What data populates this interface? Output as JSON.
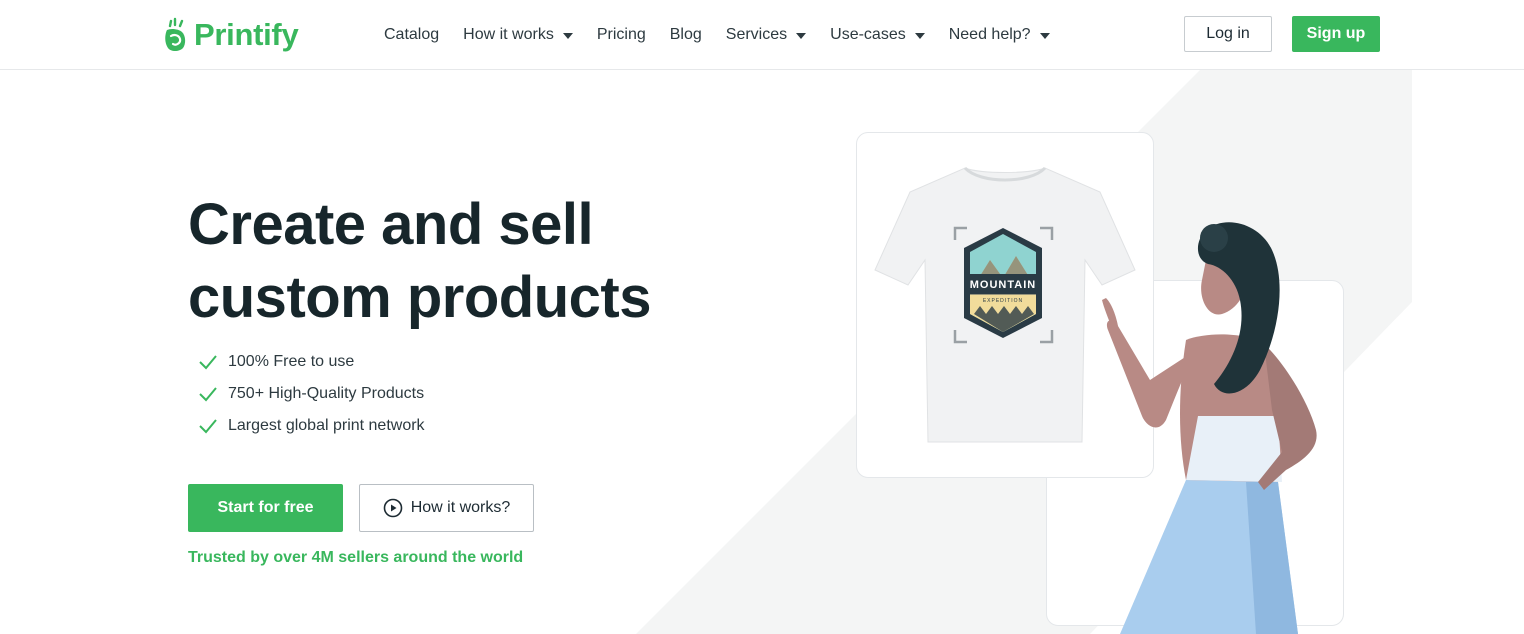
{
  "header": {
    "brand": "Printify",
    "nav": [
      {
        "label": "Catalog",
        "dropdown": false
      },
      {
        "label": "How it works",
        "dropdown": true
      },
      {
        "label": "Pricing",
        "dropdown": false
      },
      {
        "label": "Blog",
        "dropdown": false
      },
      {
        "label": "Services",
        "dropdown": true
      },
      {
        "label": "Use-cases",
        "dropdown": true
      },
      {
        "label": "Need help?",
        "dropdown": true
      }
    ],
    "login_label": "Log in",
    "signup_label": "Sign up"
  },
  "hero": {
    "title_line1": "Create and sell",
    "title_line2": "custom products",
    "features": [
      "100% Free to use",
      "750+ High-Quality Products",
      "Largest global print network"
    ],
    "start_label": "Start for free",
    "how_label": "How it works?",
    "trusted": "Trusted by over 4M sellers around the world"
  },
  "product": {
    "badge_title": "MOUNTAIN",
    "badge_subtitle": "EXPEDITION"
  },
  "colors": {
    "brand": "#39b75d",
    "text": "#17262b",
    "bg_shape": "#f4f5f5"
  },
  "icons": {
    "logo": "printify-logo-icon",
    "check": "check-icon",
    "play": "play-circle-icon",
    "caret": "caret-down-icon"
  }
}
